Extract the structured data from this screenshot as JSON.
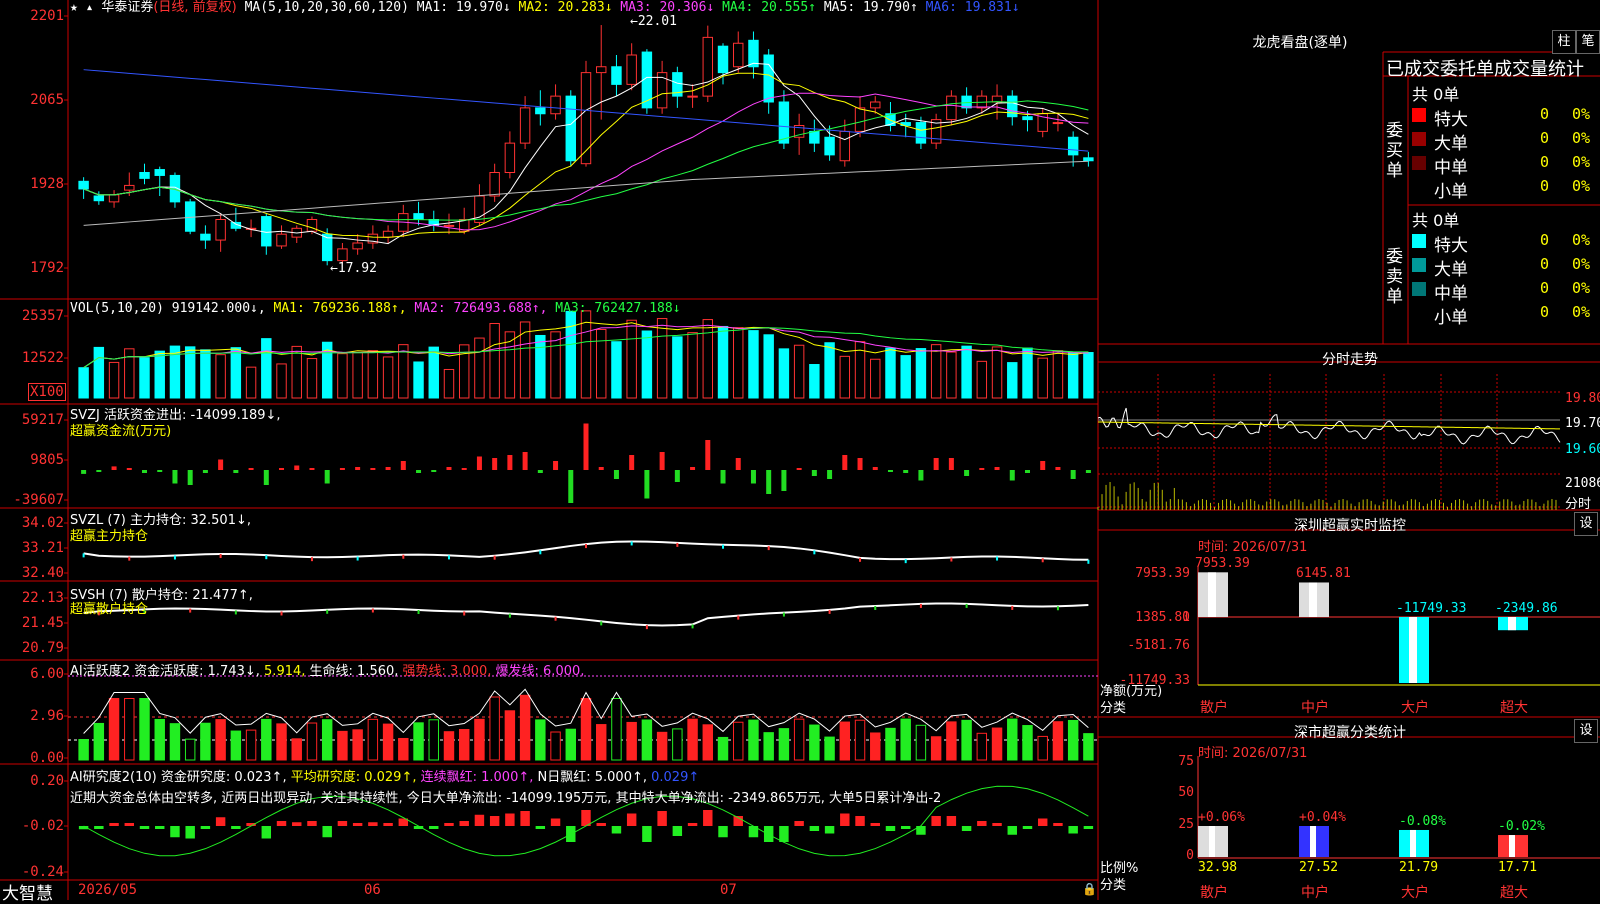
{
  "app": {
    "brand": "大智慧"
  },
  "stock": {
    "name": "华泰证券",
    "mode": "(日线, 前复权)"
  },
  "kline": {
    "ma_params": "MA(5,10,20,30,60,120)",
    "ma_values": [
      {
        "label": "MA1:",
        "value": "19.970↓",
        "color": "#ffffff"
      },
      {
        "label": "MA2:",
        "value": "20.283↓",
        "color": "#ffff00"
      },
      {
        "label": "MA3:",
        "value": "20.306↓",
        "color": "#ff44ff"
      },
      {
        "label": "MA4:",
        "value": "20.555↑",
        "color": "#22ff44"
      },
      {
        "label": "MA5:",
        "value": "19.790↑",
        "color": "#ffffff"
      },
      {
        "label": "MA6:",
        "value": "19.831↓",
        "color": "#3355ff"
      }
    ],
    "y_labels": [
      "2201",
      "2065",
      "1928",
      "1792"
    ],
    "high_marker": "22.01",
    "low_marker": "17.92",
    "candles": [
      [
        19.35,
        19.22,
        19.42,
        19.05
      ],
      [
        19.1,
        19.02,
        19.18,
        18.95
      ],
      [
        19.0,
        19.12,
        19.2,
        18.9
      ],
      [
        19.2,
        19.28,
        19.5,
        19.1
      ],
      [
        19.5,
        19.4,
        19.65,
        19.3
      ],
      [
        19.55,
        19.45,
        19.6,
        19.1
      ],
      [
        19.45,
        19.0,
        19.5,
        18.9
      ],
      [
        19.0,
        18.5,
        19.05,
        18.45
      ],
      [
        18.45,
        18.35,
        18.6,
        18.2
      ],
      [
        18.35,
        18.7,
        18.8,
        18.15
      ],
      [
        18.65,
        18.55,
        18.9,
        18.5
      ],
      [
        18.55,
        18.55,
        18.7,
        18.4
      ],
      [
        18.75,
        18.25,
        18.8,
        18.1
      ],
      [
        18.25,
        18.45,
        18.6,
        18.2
      ],
      [
        18.4,
        18.55,
        18.6,
        18.3
      ],
      [
        18.5,
        18.7,
        18.75,
        18.45
      ],
      [
        18.45,
        18.0,
        18.55,
        17.92
      ],
      [
        18.0,
        18.2,
        18.3,
        17.95
      ],
      [
        18.2,
        18.3,
        18.45,
        18.1
      ],
      [
        18.3,
        18.45,
        18.6,
        18.2
      ],
      [
        18.4,
        18.5,
        18.6,
        18.3
      ],
      [
        18.5,
        18.8,
        18.95,
        18.4
      ],
      [
        18.8,
        18.7,
        19.0,
        18.6
      ],
      [
        18.7,
        18.6,
        18.85,
        18.5
      ],
      [
        18.6,
        18.6,
        18.8,
        18.45
      ],
      [
        18.5,
        18.7,
        18.9,
        18.45
      ],
      [
        18.65,
        19.1,
        19.3,
        18.6
      ],
      [
        19.1,
        19.5,
        19.65,
        19.0
      ],
      [
        19.5,
        20.0,
        20.2,
        19.4
      ],
      [
        20.0,
        20.6,
        20.8,
        19.9
      ],
      [
        20.6,
        20.5,
        20.9,
        20.3
      ],
      [
        20.5,
        20.8,
        21.0,
        20.4
      ],
      [
        20.8,
        19.7,
        20.9,
        19.6
      ],
      [
        19.65,
        21.2,
        21.4,
        19.6
      ],
      [
        21.2,
        21.3,
        22.01,
        20.4
      ],
      [
        21.3,
        21.0,
        21.5,
        20.8
      ],
      [
        21.0,
        21.5,
        21.7,
        20.9
      ],
      [
        21.55,
        20.6,
        21.6,
        20.5
      ],
      [
        20.6,
        21.2,
        21.4,
        20.5
      ],
      [
        21.2,
        20.8,
        21.3,
        20.6
      ],
      [
        20.8,
        20.8,
        21.0,
        20.6
      ],
      [
        20.8,
        21.8,
        22.0,
        20.7
      ],
      [
        21.65,
        21.2,
        21.7,
        21.0
      ],
      [
        21.3,
        21.7,
        21.9,
        21.2
      ],
      [
        21.75,
        21.3,
        21.9,
        21.1
      ],
      [
        21.5,
        20.7,
        21.6,
        20.5
      ],
      [
        20.7,
        20.0,
        20.9,
        19.9
      ],
      [
        20.1,
        20.3,
        20.5,
        19.8
      ],
      [
        20.2,
        20.0,
        20.4,
        19.85
      ],
      [
        20.1,
        19.8,
        20.3,
        19.7
      ],
      [
        19.7,
        20.2,
        20.4,
        19.6
      ],
      [
        20.2,
        20.6,
        20.8,
        20.1
      ],
      [
        20.6,
        20.7,
        20.8,
        20.5
      ],
      [
        20.5,
        20.3,
        20.7,
        20.2
      ],
      [
        20.35,
        20.3,
        20.5,
        20.1
      ],
      [
        20.35,
        20.0,
        20.45,
        19.9
      ],
      [
        20.0,
        20.4,
        20.5,
        19.9
      ],
      [
        20.4,
        20.8,
        20.9,
        20.3
      ],
      [
        20.8,
        20.6,
        20.95,
        20.5
      ],
      [
        20.6,
        20.8,
        20.9,
        20.5
      ],
      [
        20.7,
        20.8,
        21.0,
        20.4
      ],
      [
        20.8,
        20.45,
        20.9,
        20.3
      ],
      [
        20.45,
        20.4,
        20.55,
        20.2
      ],
      [
        20.2,
        20.5,
        20.6,
        20.1
      ],
      [
        20.35,
        20.35,
        20.5,
        20.2
      ],
      [
        20.1,
        19.8,
        20.2,
        19.6
      ],
      [
        19.75,
        19.7,
        19.85,
        19.6
      ]
    ]
  },
  "vol": {
    "header_params": "VOL(5,10,20)",
    "header_value": "919142.000↓,",
    "ma_labels": [
      {
        "label": "MA1:",
        "value": "769236.188↑,",
        "color": "#ffff00"
      },
      {
        "label": "MA2:",
        "value": "726493.688↑,",
        "color": "#ff44ff"
      },
      {
        "label": "MA3:",
        "value": "762427.188↓",
        "color": "#22ff44"
      }
    ],
    "y_labels": [
      "25357",
      "12522"
    ],
    "unit": "X100"
  },
  "svzj": {
    "header": "SVZJ  活跃资金进出: -14099.189↓,",
    "sub": "超赢资金流(万元)",
    "y_labels": [
      "59217",
      "9805",
      "-39607"
    ]
  },
  "svzl": {
    "header": "SVZL (7) 主力持仓: 32.501↓,",
    "sub": "超赢主力持仓",
    "y_labels": [
      "34.02",
      "33.21",
      "32.40"
    ]
  },
  "svsh": {
    "header": "SVSH (7) 散户持仓: 21.477↑,",
    "sub": "超赢散户持仓",
    "y_labels": [
      "22.13",
      "21.45",
      "20.79"
    ]
  },
  "ai_act": {
    "header_name": "AI活跃度2",
    "items": [
      {
        "text": "资金活跃度: 1.743↓,",
        "color": "#ffffff"
      },
      {
        "text": "5.914,",
        "color": "#ffff00"
      },
      {
        "text": "生命线: 1.560,",
        "color": "#ffffff"
      },
      {
        "text": "强势线: 3.000,",
        "color": "#ff3333"
      },
      {
        "text": "爆发线: 6.000,",
        "color": "#ff44ff"
      }
    ],
    "y_labels": [
      "6.00",
      "2.96",
      "0.00"
    ]
  },
  "ai_res": {
    "header_name": "AI研究度2(10)",
    "items": [
      {
        "text": "资金研究度: 0.023↑,",
        "color": "#ffffff"
      },
      {
        "text": "平均研究度: 0.029↑,",
        "color": "#ffff00"
      },
      {
        "text": "连续飘红: 1.000↑,",
        "color": "#ff44ff"
      },
      {
        "text": "N日飘红: 5.000↑,",
        "color": "#ffffff"
      },
      {
        "text": "0.029↑",
        "color": "#3355ff"
      }
    ],
    "comment": "近期大资金总体由空转多, 近两日出现异动, 关注其持续性, 今日大单净流出: -14099.195万元, 其中特大单净流出: -2349.865万元, 大单5日累计净出-2",
    "y_labels": [
      "0.20",
      "-0.02",
      "-0.24"
    ]
  },
  "dates": [
    "2026/05",
    "06",
    "07"
  ],
  "right": {
    "lhb_title": "龙虎看盘(逐单)",
    "btn_zhu": "柱",
    "btn_bi": "笔",
    "order_header": "已成交委托单成交量统计",
    "buy": {
      "label": "委买单",
      "total": "共 0单",
      "rows": [
        {
          "name": "特大",
          "count": "0",
          "pct": "0%",
          "color": "#ff0000"
        },
        {
          "name": "大单",
          "count": "0",
          "pct": "0%",
          "color": "#990000"
        },
        {
          "name": "中单",
          "count": "0",
          "pct": "0%",
          "color": "#660000"
        },
        {
          "name": "小单",
          "count": "0",
          "pct": "0%",
          "color": "#000000"
        }
      ]
    },
    "sell": {
      "label": "委卖单",
      "total": "共 0单",
      "rows": [
        {
          "name": "特大",
          "count": "0",
          "pct": "0%",
          "color": "#00ffff"
        },
        {
          "name": "大单",
          "count": "0",
          "pct": "0%",
          "color": "#009999"
        },
        {
          "name": "中单",
          "count": "0",
          "pct": "0%",
          "color": "#007777"
        },
        {
          "name": "小单",
          "count": "0",
          "pct": "0%",
          "color": "#000000"
        }
      ]
    },
    "fenshi_title": "分时走势",
    "fenshi_y": [
      "19.80",
      "19.70",
      "19.60"
    ],
    "fenshi_vol": "21086",
    "fenshi_unit": "分时",
    "monitor_title": "深圳超赢实时监控",
    "monitor_btn": "设",
    "monitor_time": "时间: 2026/07/31",
    "monitor_y": [
      "7953.39",
      "1385.81",
      "0",
      "-5181.76",
      "-11749.33"
    ],
    "monitor_ylabel": "净额(万元)",
    "monitor_xlabel": "分类",
    "monitor_cats": [
      "散户",
      "中户",
      "大户",
      "超大"
    ],
    "monitor_values": [
      "7953.39",
      "6145.81",
      "-11749.33",
      "-2349.86"
    ],
    "stat_title": "深市超赢分类统计",
    "stat_btn": "设",
    "stat_time": "时间: 2026/07/31",
    "stat_y": [
      "75",
      "50",
      "25",
      "0"
    ],
    "stat_ylabel": "比例%",
    "stat_xlabel": "分类",
    "stat_cats": [
      "散户",
      "中户",
      "大户",
      "超大"
    ],
    "stat_values": [
      "32.98",
      "27.52",
      "21.79",
      "17.71"
    ],
    "stat_changes": [
      "+0.06%",
      "+0.04%",
      "-0.08%",
      "-0.02%"
    ]
  },
  "chart_data": {
    "type": "candlestick",
    "title": "华泰证券 (日线, 前复权)",
    "series": [
      {
        "name": "K线",
        "values": "see kline.candles [open, close, high, low]"
      }
    ],
    "ylim": [
      17.92,
      22.01
    ]
  }
}
